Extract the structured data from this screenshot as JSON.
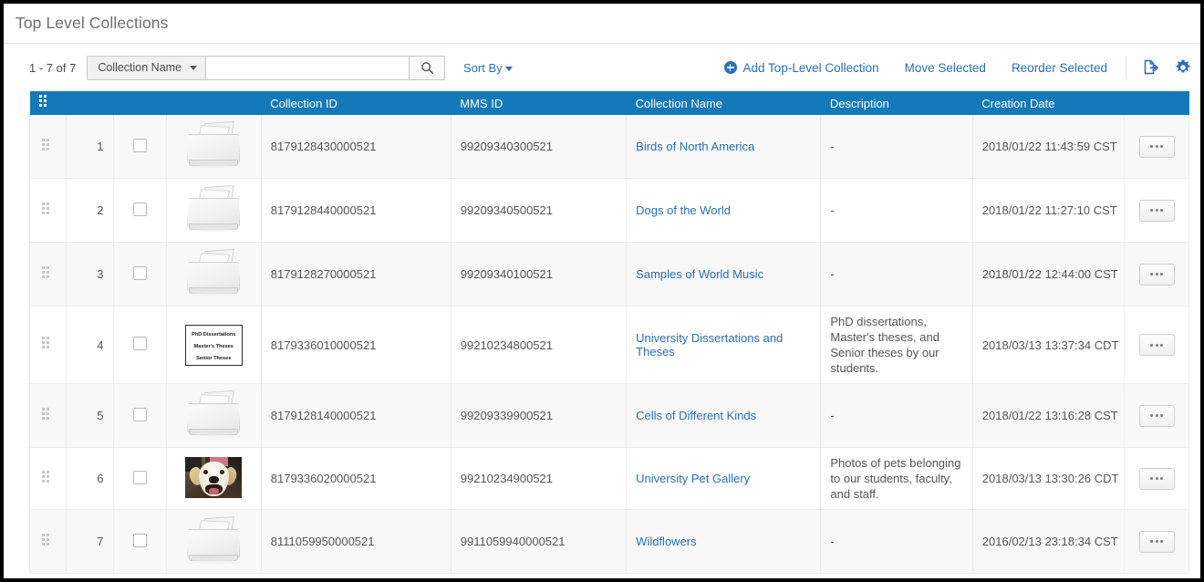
{
  "page": {
    "title": "Top Level Collections"
  },
  "toolbar": {
    "result_count": "1 - 7 of 7",
    "search_field_label": "Collection Name",
    "search_value": "",
    "search_placeholder": "",
    "search_button_icon": "search-icon",
    "sort_by_label": "Sort By",
    "add_collection_label": "Add Top-Level Collection",
    "move_selected_label": "Move Selected",
    "reorder_selected_label": "Reorder Selected",
    "export_icon": "export-icon",
    "settings_icon": "gear-icon"
  },
  "table": {
    "columns": [
      {
        "key": "handle",
        "label": ""
      },
      {
        "key": "num",
        "label": ""
      },
      {
        "key": "check",
        "label": ""
      },
      {
        "key": "thumb",
        "label": ""
      },
      {
        "key": "collection_id",
        "label": "Collection ID"
      },
      {
        "key": "mms_id",
        "label": "MMS ID"
      },
      {
        "key": "collection_name",
        "label": "Collection Name"
      },
      {
        "key": "description",
        "label": "Description"
      },
      {
        "key": "creation_date",
        "label": "Creation Date"
      },
      {
        "key": "actions",
        "label": ""
      }
    ],
    "rows": [
      {
        "num": "1",
        "thumbnail": "default-collection",
        "collection_id": "8179128430000521",
        "mms_id": "99209340300521",
        "collection_name": "Birds of North America",
        "description": "-",
        "creation_date": "2018/01/22 11:43:59 CST"
      },
      {
        "num": "2",
        "thumbnail": "default-collection",
        "collection_id": "8179128440000521",
        "mms_id": "99209340500521",
        "collection_name": "Dogs of the World",
        "description": "-",
        "creation_date": "2018/01/22 11:27:10 CST"
      },
      {
        "num": "3",
        "thumbnail": "default-collection",
        "collection_id": "8179128270000521",
        "mms_id": "99209340100521",
        "collection_name": "Samples of World Music",
        "description": "-",
        "creation_date": "2018/01/22 12:44:00 CST"
      },
      {
        "num": "4",
        "thumbnail": "text-slide",
        "thumbnail_lines": [
          "PhD Dissertations",
          "Master's Theses",
          "Senior Theses"
        ],
        "collection_id": "8179336010000521",
        "mms_id": "99210234800521",
        "collection_name": "University Dissertations and Theses",
        "description": "PhD dissertations, Master's theses, and Senior theses by our students.",
        "creation_date": "2018/03/13 13:37:34 CDT"
      },
      {
        "num": "5",
        "thumbnail": "default-collection",
        "collection_id": "8179128140000521",
        "mms_id": "99209339900521",
        "collection_name": "Cells of Different Kinds",
        "description": "-",
        "creation_date": "2018/01/22 13:16:28 CST"
      },
      {
        "num": "6",
        "thumbnail": "dog-photo",
        "collection_id": "8179336020000521",
        "mms_id": "99210234900521",
        "collection_name": "University Pet Gallery",
        "description": "Photos of pets belonging to our students, faculty, and staff.",
        "creation_date": "2018/03/13 13:30:26 CDT"
      },
      {
        "num": "7",
        "thumbnail": "default-collection",
        "collection_id": "8111059950000521",
        "mms_id": "9911059940000521",
        "collection_name": "Wildflowers",
        "description": "-",
        "creation_date": "2016/02/13 23:18:34 CST"
      }
    ],
    "row_action_icon": "ellipsis-icon"
  },
  "colors": {
    "header_blue": "#1479b8",
    "link_blue": "#2a6ebb",
    "row_alt": "#f8f8f8"
  }
}
